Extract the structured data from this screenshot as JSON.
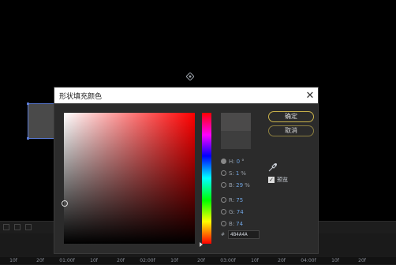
{
  "dialog": {
    "title": "形状填充颜色",
    "close_label": "✕",
    "ok_label": "确定",
    "cancel_label": "取消",
    "modes": [
      {
        "key": "H",
        "value": "0",
        "unit": "°",
        "selected": true
      },
      {
        "key": "S",
        "value": "1",
        "unit": "%",
        "selected": false
      },
      {
        "key": "B",
        "value": "29",
        "unit": "%",
        "selected": false
      },
      {
        "key": "R",
        "value": "75",
        "unit": "",
        "selected": false
      },
      {
        "key": "G",
        "value": "74",
        "unit": "",
        "selected": false
      },
      {
        "key": "B",
        "value": "74",
        "unit": "",
        "selected": false
      }
    ],
    "preview_checkbox_label": "预览",
    "preview_checked": true,
    "hex_label": "#",
    "hex_value": "4B4A4A",
    "new_color": "#4B4A4A",
    "current_color": "#3E3E3E"
  },
  "timeline": {
    "ruler": [
      "10f",
      "20f",
      "01:00f",
      "10f",
      "20f",
      "02:00f",
      "10f",
      "20f",
      "03:00f",
      "10f",
      "20f",
      "04:00f",
      "10f",
      "20f"
    ]
  },
  "colors": {
    "selection": "#5B7BD6",
    "button_border": "#C9B24A",
    "value_text": "#6FA3E0"
  }
}
